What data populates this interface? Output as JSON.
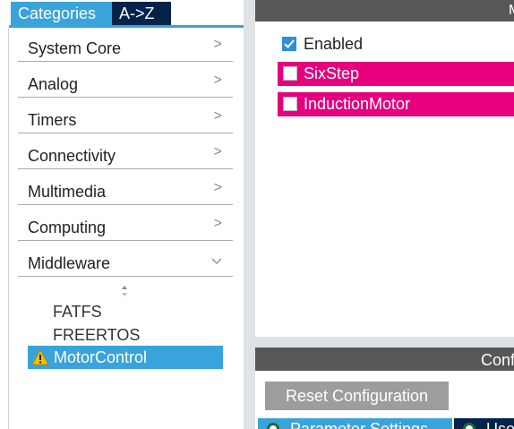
{
  "tabs": {
    "categories": "Categories",
    "az": "A->Z"
  },
  "categories": [
    {
      "label": "System Core",
      "chevron": ">"
    },
    {
      "label": "Analog",
      "chevron": ">"
    },
    {
      "label": "Timers",
      "chevron": ">"
    },
    {
      "label": "Connectivity",
      "chevron": ">"
    },
    {
      "label": "Multimedia",
      "chevron": ">"
    },
    {
      "label": "Computing",
      "chevron": ">"
    },
    {
      "label": "Middleware",
      "chevron": "v"
    }
  ],
  "middleware_items": [
    "FATFS",
    "FREERTOS",
    "MotorControl"
  ],
  "mode_header": "M",
  "mode": {
    "enabled_label": "Enabled",
    "enabled_checked": true,
    "options": [
      "SixStep",
      "InductionMotor"
    ]
  },
  "config_header": "Conf",
  "reset_button": "Reset Configuration",
  "bottom_tabs": [
    "Parameter Settings",
    "User"
  ],
  "colors": {
    "accent_blue": "#39a3dc",
    "navy": "#03234b",
    "magenta": "#e6007e",
    "header_gray": "#575757"
  }
}
